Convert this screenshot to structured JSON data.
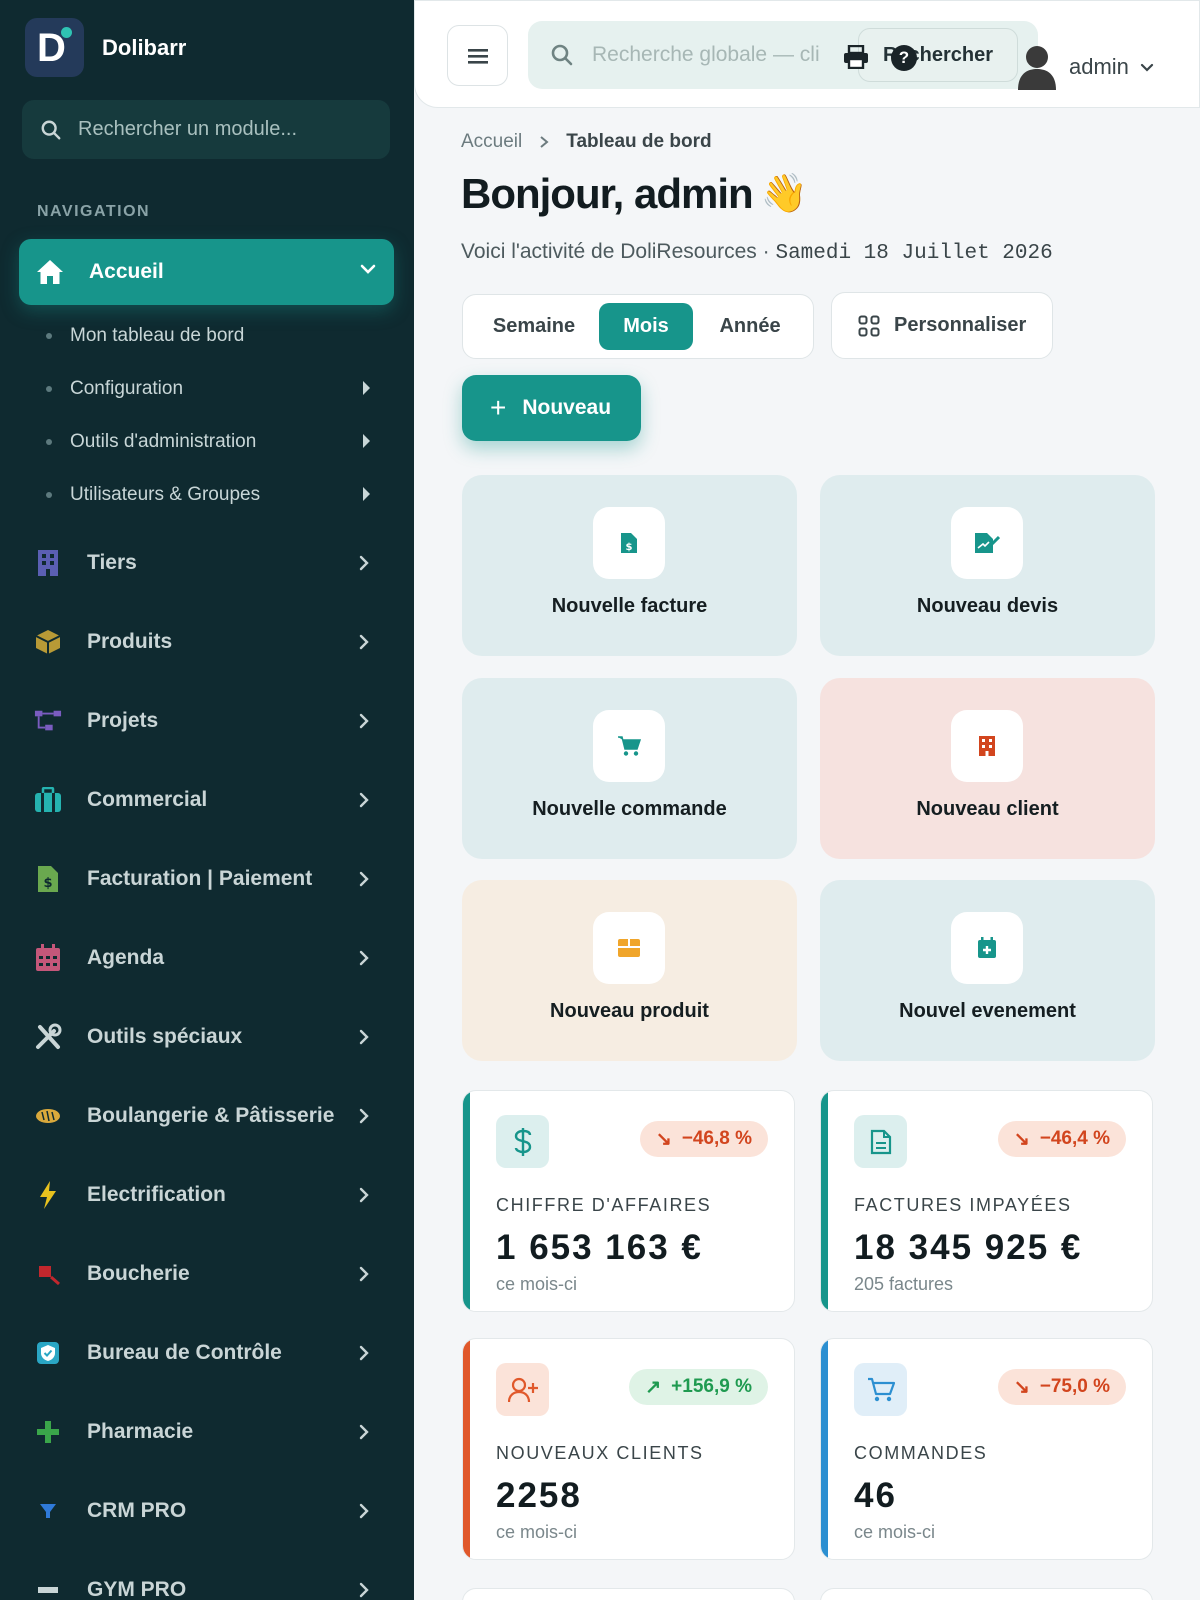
{
  "brand": {
    "name": "Dolibarr",
    "logo_letter": "D",
    "accent": "#17958b"
  },
  "sidebar": {
    "search_placeholder": "Rechercher un module...",
    "section_label": "NAVIGATION",
    "active": {
      "label": "Accueil",
      "icon": "home-icon"
    },
    "subitems": [
      {
        "label": "Mon tableau de bord",
        "has_arrow": false
      },
      {
        "label": "Configuration",
        "has_arrow": true
      },
      {
        "label": "Outils d'administration",
        "has_arrow": true
      },
      {
        "label": "Utilisateurs & Groupes",
        "has_arrow": true
      }
    ],
    "items": [
      {
        "label": "Tiers",
        "icon": "building-icon",
        "color": "#5b5fb3"
      },
      {
        "label": "Produits",
        "icon": "box-icon",
        "color": "#b89a36"
      },
      {
        "label": "Projets",
        "icon": "project-tree-icon",
        "color": "#7a5cc0"
      },
      {
        "label": "Commercial",
        "icon": "briefcase-icon",
        "color": "#25b3b0"
      },
      {
        "label": "Facturation | Paiement",
        "icon": "invoice-icon",
        "color": "#6aa84f"
      },
      {
        "label": "Agenda",
        "icon": "calendar-icon",
        "color": "#c4577a"
      },
      {
        "label": "Outils spéciaux",
        "icon": "tools-icon",
        "color": "#c9d5d6"
      },
      {
        "label": "Boulangerie & Pâtisserie",
        "icon": "bread-icon",
        "color": "#d9a93c"
      },
      {
        "label": "Electrification",
        "icon": "bolt-icon",
        "color": "#e8c21e"
      },
      {
        "label": "Boucherie",
        "icon": "knife-icon",
        "color": "#c2272d"
      },
      {
        "label": "Bureau de Contrôle",
        "icon": "shield-check-icon",
        "color": "#2aa6c4"
      },
      {
        "label": "Pharmacie",
        "icon": "plus-cross-icon",
        "color": "#3aa64a"
      },
      {
        "label": "CRM PRO",
        "icon": "funnel-icon",
        "color": "#2f7ad9"
      },
      {
        "label": "GYM PRO",
        "icon": "gym-icon",
        "color": "#c9d5d6"
      }
    ]
  },
  "topbar": {
    "search_placeholder": "Recherche globale — cli",
    "search_button": "Rechercher",
    "help_glyph": "?",
    "user_name": "admin"
  },
  "breadcrumb": {
    "home": "Accueil",
    "current": "Tableau de bord"
  },
  "greeting": {
    "title": "Bonjour, admin",
    "wave": "👋",
    "subtitle": "Voici l'activité de DoliResources · ",
    "date": "Samedi 18 Juillet 2026"
  },
  "period": {
    "options": [
      "Semaine",
      "Mois",
      "Année"
    ],
    "selected": "Mois"
  },
  "customize_label": "Personnaliser",
  "new_button": "Nouveau",
  "quick_actions": [
    {
      "label": "Nouvelle facture",
      "icon": "invoice-icon",
      "bg": "#dfecee",
      "color": "#17958b"
    },
    {
      "label": "Nouveau devis",
      "icon": "quote-signature-icon",
      "bg": "#dfecee",
      "color": "#17958b"
    },
    {
      "label": "Nouvelle commande",
      "icon": "cart-icon",
      "bg": "#dfecee",
      "color": "#17958b"
    },
    {
      "label": "Nouveau client",
      "icon": "building-icon",
      "bg": "#f6e2df",
      "color": "#d2451e"
    },
    {
      "label": "Nouveau produit",
      "icon": "box-icon",
      "bg": "#f6ede2",
      "color": "#f0a52a"
    },
    {
      "label": "Nouvel evenement",
      "icon": "calendar-plus-icon",
      "bg": "#dfecee",
      "color": "#17958b"
    }
  ],
  "kpis": [
    {
      "title": "CHIFFRE D'AFFAIRES",
      "value": "1 653 163 €",
      "note": "ce mois-ci",
      "trend": "−46,8 %",
      "direction": "down",
      "icon": "dollar-icon",
      "accent": "#17958b",
      "icon_bg": "#dcefee"
    },
    {
      "title": "FACTURES IMPAYÉES",
      "value": "18 345 925 €",
      "note": "205 factures",
      "trend": "−46,4 %",
      "direction": "down",
      "icon": "document-icon",
      "accent": "#17958b",
      "icon_bg": "#dcefee"
    },
    {
      "title": "NOUVEAUX CLIENTS",
      "value": "2258",
      "note": "ce mois-ci",
      "trend": "+156,9 %",
      "direction": "up",
      "icon": "user-plus-icon",
      "accent": "#e0582b",
      "icon_bg": "#fbe3d9"
    },
    {
      "title": "COMMANDES",
      "value": "46",
      "note": "ce mois-ci",
      "trend": "−75,0 %",
      "direction": "down",
      "icon": "cart-icon",
      "accent": "#2c8fd1",
      "icon_bg": "#e0eef8"
    }
  ]
}
